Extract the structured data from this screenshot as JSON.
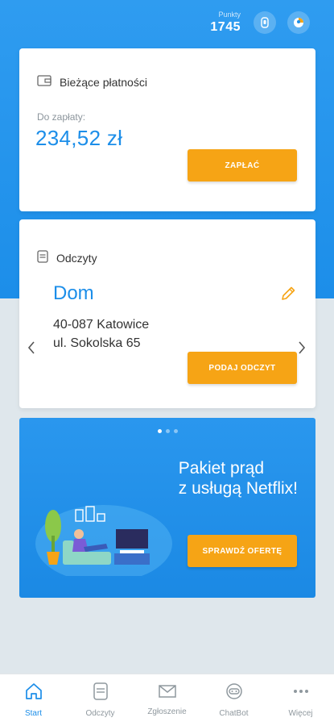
{
  "header": {
    "points_label": "Punkty",
    "points_value": "1745",
    "icons": [
      "badge-icon",
      "profile-icon"
    ]
  },
  "payments": {
    "title": "Bieżące płatności",
    "due_label": "Do zapłaty:",
    "amount": "234,52 zł",
    "button": "ZAPŁAĆ"
  },
  "readings": {
    "title": "Odczyty",
    "place": "Dom",
    "address_line1": "40-087 Katowice",
    "address_line2": "ul. Sokolska 65",
    "button": "PODAJ ODCZYT"
  },
  "promo": {
    "title_line1": "Pakiet prąd",
    "title_line2": "z usługą Netflix!",
    "button": "SPRAWDŹ OFERTĘ",
    "slide_index": 1,
    "slide_count": 3
  },
  "nav": {
    "items": [
      {
        "label": "Start",
        "icon": "home-icon",
        "active": true
      },
      {
        "label": "Odczyty",
        "icon": "meter-icon",
        "active": false
      },
      {
        "label": "Zgłoszenie",
        "icon": "envelope-icon",
        "active": false
      },
      {
        "label": "ChatBot",
        "icon": "chatbot-icon",
        "active": false
      },
      {
        "label": "Więcej",
        "icon": "more-icon",
        "active": false
      }
    ]
  },
  "colors": {
    "primary": "#1c8ee9",
    "accent": "#f6a415",
    "background": "#dfe7ec"
  }
}
